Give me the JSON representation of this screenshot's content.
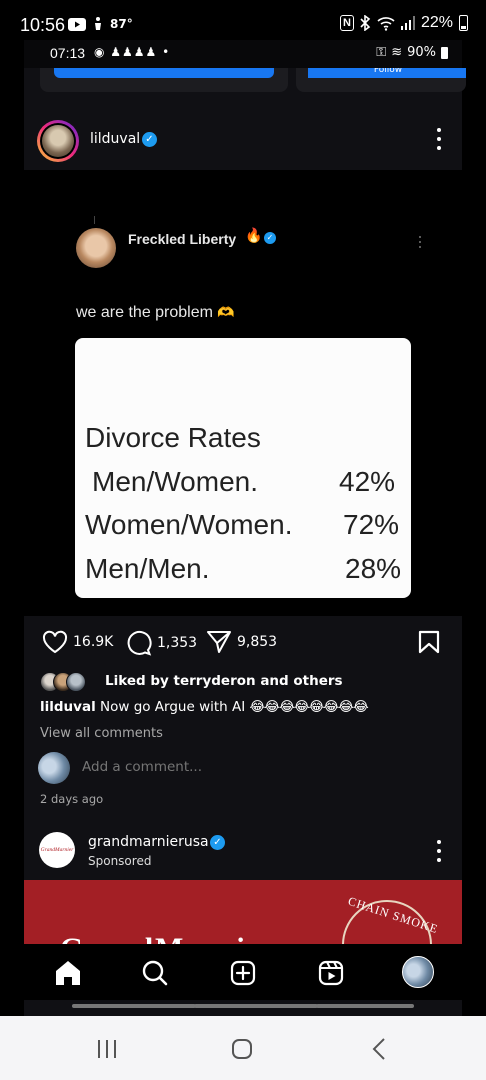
{
  "outer_status": {
    "time": "10:56",
    "temp": "87°",
    "battery": "22%",
    "nfc": "N"
  },
  "inner_status": {
    "time": "07:13",
    "battery": "90%"
  },
  "prev_card": {
    "follow_label": "Follow"
  },
  "post": {
    "username": "lilduval",
    "tweet": {
      "name": "Freckled Liberty",
      "text": "we are the problem",
      "hands_emoji": "🫶",
      "fire_emoji": "🔥",
      "card_title": "Divorce Rates",
      "rows": [
        {
          "label": "Men/Women.",
          "pct": "42%"
        },
        {
          "label": "Women/Women.",
          "pct": "72%"
        },
        {
          "label": "Men/Men.",
          "pct": "28%"
        }
      ]
    },
    "likes_count": "16.9K",
    "comments_count": "1,353",
    "shares_count": "9,853",
    "liked_by": "Liked by terryderon and others",
    "caption_user": "lilduval",
    "caption_text": "Now go Argue with AI",
    "caption_emojis": "😂😂😂😂😂😂😂😂",
    "view_comments": "View all comments",
    "add_comment_placeholder": "Add a comment...",
    "timestamp": "2 days ago"
  },
  "sponsored": {
    "name": "grandmarnierusa",
    "label": "Sponsored",
    "logo_text": "GrandMarnier",
    "ad_brand": "GrandMarnier",
    "ad_badge": "CHAIN SMOKE"
  },
  "colors": {
    "accent_blue": "#1d9bf0",
    "ad_red": "#a31f25"
  }
}
